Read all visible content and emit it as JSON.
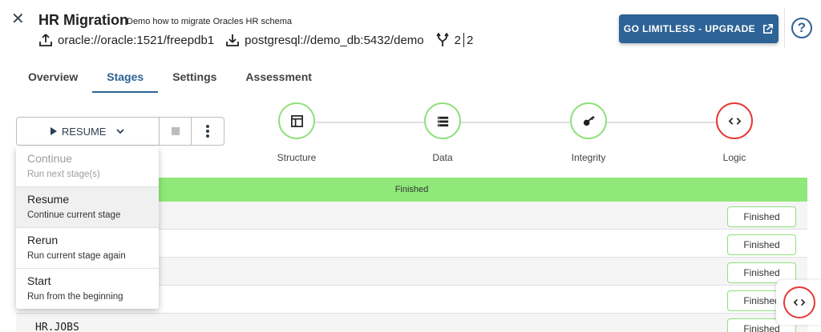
{
  "header": {
    "title": "HR Migration",
    "subtitle": "Demo how to migrate Oracles HR schema",
    "source": "oracle://oracle:1521/freepdb1",
    "target": "postgresql://demo_db:5432/demo",
    "branch_left": "2",
    "branch_right": "2",
    "upgrade_label": "GO LIMITLESS - UPGRADE",
    "help_label": "?"
  },
  "tabs": [
    {
      "label": "Overview"
    },
    {
      "label": "Stages"
    },
    {
      "label": "Settings"
    },
    {
      "label": "Assessment"
    }
  ],
  "controls": {
    "resume_label": "RESUME"
  },
  "stages": [
    {
      "label": "Structure",
      "status_color": "#8fe07b"
    },
    {
      "label": "Data",
      "status_color": "#8fe07b"
    },
    {
      "label": "Integrity",
      "status_color": "#8fe07b"
    },
    {
      "label": "Logic",
      "status_color": "#e53935"
    }
  ],
  "status_bar": "Finished",
  "rows": [
    {
      "name": "",
      "status": "Finished"
    },
    {
      "name": "",
      "status": "Finished"
    },
    {
      "name": "",
      "status": "Finished"
    },
    {
      "name": "",
      "status": "Finished"
    },
    {
      "name": "HR.JOBS",
      "status": "Finished"
    }
  ],
  "menu": [
    {
      "label": "Continue",
      "desc": "Run next stage(s)"
    },
    {
      "label": "Resume",
      "desc": "Continue current stage"
    },
    {
      "label": "Rerun",
      "desc": "Run current stage again"
    },
    {
      "label": "Start",
      "desc": "Run from the beginning"
    }
  ],
  "colors": {
    "primary": "#2d6396",
    "success": "#8fe879",
    "danger": "#e53935"
  }
}
